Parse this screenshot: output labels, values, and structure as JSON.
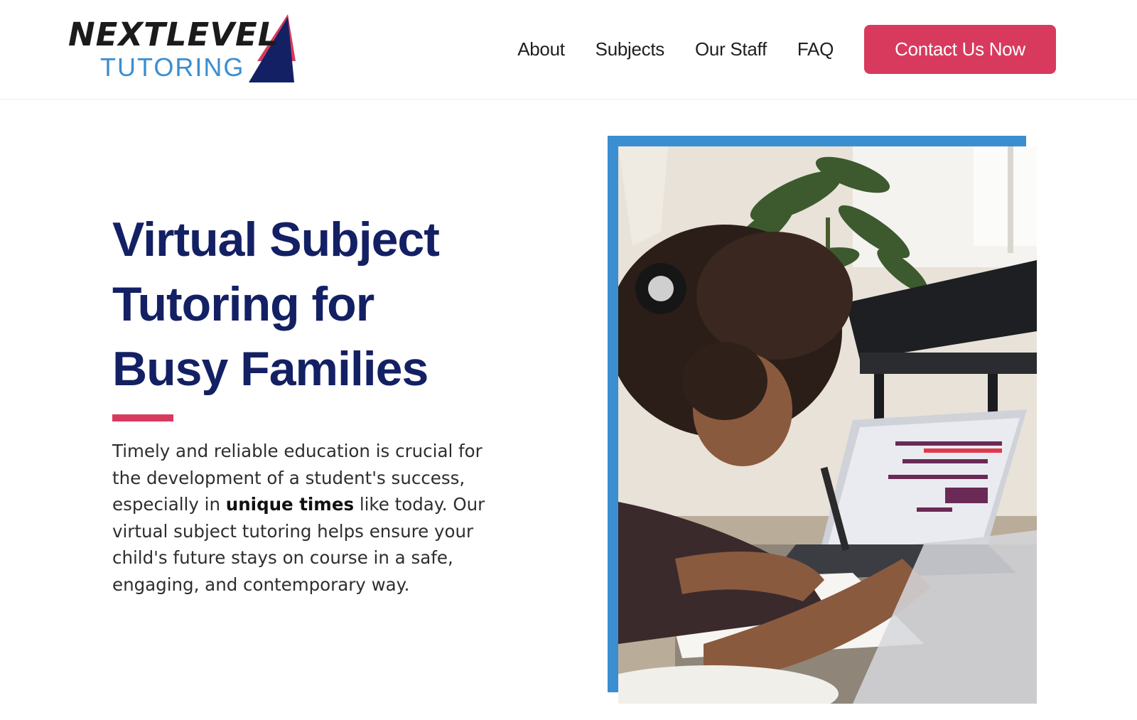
{
  "header": {
    "logo": {
      "word_top": "NEXTLEVEL",
      "word_bottom": "TUTORING",
      "colors": {
        "dark": "#1b1b1b",
        "blue": "#3b8ed0",
        "navy": "#142064",
        "red": "#d83a5e"
      }
    },
    "nav": {
      "items": [
        {
          "label": "About"
        },
        {
          "label": "Subjects"
        },
        {
          "label": "Our Staff"
        },
        {
          "label": "FAQ"
        }
      ],
      "cta_label": "Contact Us Now"
    }
  },
  "hero": {
    "title_lines": [
      "Virtual Subject",
      "Tutoring for",
      "Busy Families"
    ],
    "body_part1": "Timely and reliable education is crucial for the development of a student's success, especially in ",
    "body_bold": "unique times",
    "body_part2": " like today. Our virtual subject tutoring helps ensure your child's future stays on course in a safe, engaging, and contemporary way."
  },
  "image": {
    "icon": "photo-student-headphones-laptop",
    "frame_color": "#3b8ed0"
  },
  "colors": {
    "accent": "#d83a5e",
    "heading": "#142064",
    "frame": "#3b8ed0"
  }
}
